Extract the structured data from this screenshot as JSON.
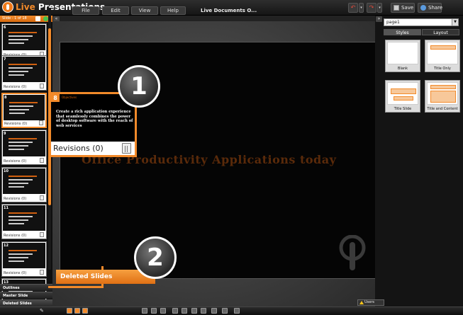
{
  "app": {
    "brand_live": "Live",
    "brand_rest": " Presentations",
    "doc_title": "Live Documents  O...",
    "menu": [
      "File",
      "Edit",
      "View",
      "Help"
    ],
    "save_label": "Save",
    "share_label": "Share"
  },
  "left_panel": {
    "header": "Slide - 1 of 18",
    "thumbnails": [
      {
        "num": "6",
        "rev": "Revisions (0)"
      },
      {
        "num": "7",
        "rev": "Revisions (0)"
      },
      {
        "num": "8",
        "rev": "Revisions (0)",
        "selected": true
      },
      {
        "num": "9",
        "rev": "Revisions (0)"
      },
      {
        "num": "10",
        "rev": "Revisions (0)"
      },
      {
        "num": "11",
        "rev": "Revisions (0)"
      },
      {
        "num": "12",
        "rev": "Revisions (0)"
      },
      {
        "num": "13",
        "rev": ""
      }
    ],
    "tabs": [
      "Outlines",
      "Master Slide",
      "Deleted Slides"
    ]
  },
  "slide": {
    "title": "Office Productivity Applications today"
  },
  "callout": {
    "number": "8",
    "subtitle": "Objectives",
    "text": "Create a rich application experience that seamlessly combines the power of desktop software with the reach of web services",
    "revisions": "Revisions (0)",
    "step1": "1",
    "step2": "2",
    "deleted_label": "Deleted Slides"
  },
  "right_panel": {
    "page_value": "page1",
    "tabs": [
      "Styles",
      "Layout"
    ],
    "layouts": [
      "Blank",
      "Title Only",
      "Title Slide",
      "Title and Content"
    ]
  },
  "bottom": {
    "users_label": "Users"
  },
  "colors": {
    "accent": "#f28a2a"
  }
}
